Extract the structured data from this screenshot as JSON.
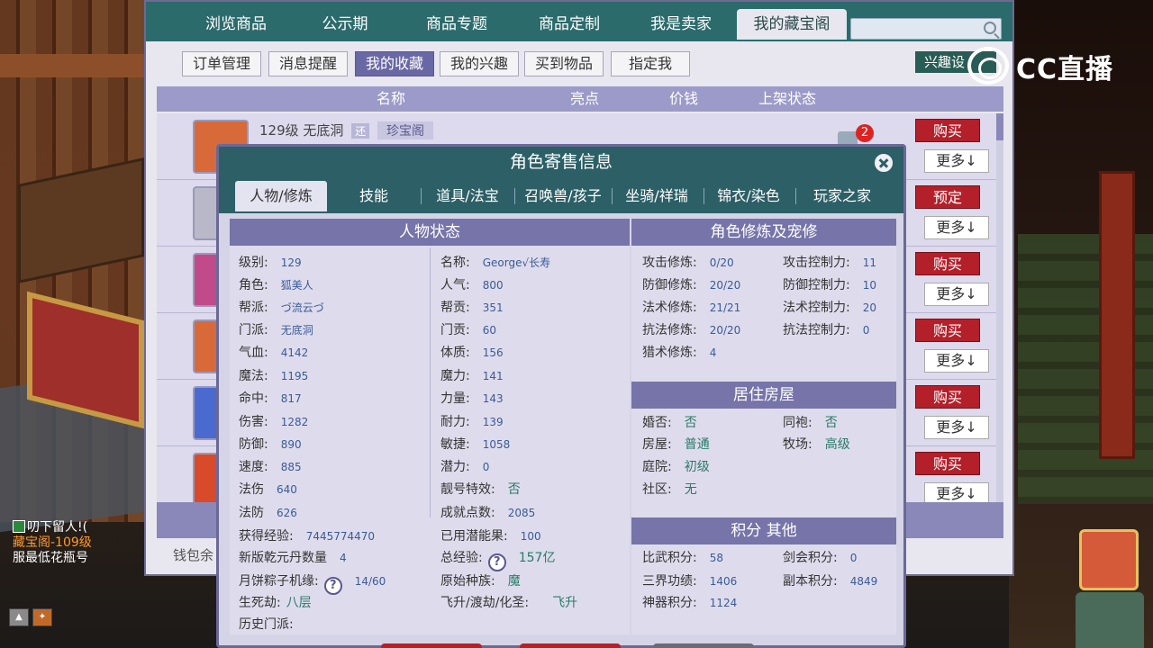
{
  "main_window": {
    "tabs": [
      "浏览商品",
      "公示期",
      "商品专题",
      "商品定制",
      "我是卖家",
      "我的藏宝阁"
    ],
    "sub_tabs": [
      "订单管理",
      "消息提醒",
      "我的收藏",
      "我的兴趣",
      "买到物品",
      "指定我"
    ],
    "interest_button": "兴趣设",
    "table_headers": [
      "名称",
      "亮点",
      "价钱",
      "上架状态"
    ],
    "rows": [
      {
        "level": "129级",
        "school": "无底洞",
        "tag": "还",
        "tag2": "珍宝阁",
        "badge": "2",
        "buy": "购买",
        "more": "更多↓"
      },
      {
        "buy": "预定",
        "more": "更多↓"
      },
      {
        "buy": "购买",
        "more": "更多↓"
      },
      {
        "buy": "购买",
        "more": "更多↓"
      },
      {
        "buy": "购买",
        "more": "更多↓"
      },
      {
        "buy": "购买",
        "more": "更多↓"
      }
    ],
    "money_label": "钱包余"
  },
  "chat": {
    "line1": "叨下留人!(",
    "line2": "藏宝阁-109级",
    "line3": "服最低花瓶号"
  },
  "watermark": {
    "text": "CC直播"
  },
  "dialog": {
    "title": "角色寄售信息",
    "tabs": [
      "人物/修炼",
      "技能",
      "道具/法宝",
      "召唤兽/孩子",
      "坐骑/祥瑞",
      "锦衣/染色",
      "玩家之家"
    ],
    "status_title": "人物状态",
    "status_left": [
      {
        "k": "级别:",
        "v": "129"
      },
      {
        "k": "角色:",
        "v": "狐美人"
      },
      {
        "k": "帮派:",
        "v": "づ流云づ"
      },
      {
        "k": "门派:",
        "v": "无底洞"
      },
      {
        "k": "气血:",
        "v": "4142"
      },
      {
        "k": "魔法:",
        "v": "1195"
      },
      {
        "k": "命中:",
        "v": "817"
      },
      {
        "k": "伤害:",
        "v": "1282"
      },
      {
        "k": "防御:",
        "v": "890"
      },
      {
        "k": "速度:",
        "v": "885"
      },
      {
        "k": "法伤",
        "v": "640"
      },
      {
        "k": "法防",
        "v": "626"
      }
    ],
    "status_right": [
      {
        "k": "名称:",
        "v": "George√长寿"
      },
      {
        "k": "人气:",
        "v": "800"
      },
      {
        "k": "帮贡:",
        "v": "351"
      },
      {
        "k": "门贡:",
        "v": "60"
      },
      {
        "k": "体质:",
        "v": "156"
      },
      {
        "k": "魔力:",
        "v": "141"
      },
      {
        "k": "力量:",
        "v": "143"
      },
      {
        "k": "耐力:",
        "v": "139"
      },
      {
        "k": "敏捷:",
        "v": "1058"
      },
      {
        "k": "潜力:",
        "v": "0"
      },
      {
        "k": "靓号特效:",
        "v": "否"
      },
      {
        "k": "成就点数:",
        "v": "2085"
      }
    ],
    "extra": {
      "exp_k": "获得经验:",
      "exp_v": "7445774470",
      "used_k": "已用潜能果:",
      "used_v": "100",
      "qianyuan_k": "新版乾元丹数量",
      "qianyuan_v": "4",
      "total_exp_k": "总经验:",
      "total_exp_v": "157亿",
      "mooncake_k": "月饼粽子机缘:",
      "mooncake_v": "14/60",
      "race_k": "原始种族:",
      "race_v": "魔",
      "shengsi_k": "生死劫:",
      "shengsi_v": "八层",
      "feisheng_k": "飞升/渡劫/化圣:",
      "feisheng_v": "飞升",
      "history_k": "历史门派:"
    },
    "cultivation_title": "角色修炼及宠修",
    "cultivation": [
      {
        "k": "攻击修炼:",
        "v": "0/20",
        "k2": "攻击控制力:",
        "v2": "11"
      },
      {
        "k": "防御修炼:",
        "v": "20/20",
        "k2": "防御控制力:",
        "v2": "10"
      },
      {
        "k": "法术修炼:",
        "v": "21/21",
        "k2": "法术控制力:",
        "v2": "20"
      },
      {
        "k": "抗法修炼:",
        "v": "20/20",
        "k2": "抗法控制力:",
        "v2": "0"
      },
      {
        "k": "猎术修炼:",
        "v": "4",
        "k2": "",
        "v2": ""
      }
    ],
    "house_title": "居住房屋",
    "house": [
      {
        "k": "婚否:",
        "v": "否",
        "k2": "同袍:",
        "v2": "否"
      },
      {
        "k": "房屋:",
        "v": "普通",
        "k2": "牧场:",
        "v2": "高级"
      },
      {
        "k": "庭院:",
        "v": "初级",
        "k2": "",
        "v2": ""
      },
      {
        "k": "社区:",
        "v": "无",
        "k2": "",
        "v2": ""
      }
    ],
    "points_title": "积分 其他",
    "points": [
      {
        "k": "比武积分:",
        "v": "58",
        "k2": "剑会积分:",
        "v2": "0"
      },
      {
        "k": "三界功绩:",
        "v": "1406",
        "k2": "副本积分:",
        "v2": "4849"
      },
      {
        "k": "神器积分:",
        "v": "1124",
        "k2": "",
        "v2": ""
      }
    ],
    "question_mark": "?"
  }
}
